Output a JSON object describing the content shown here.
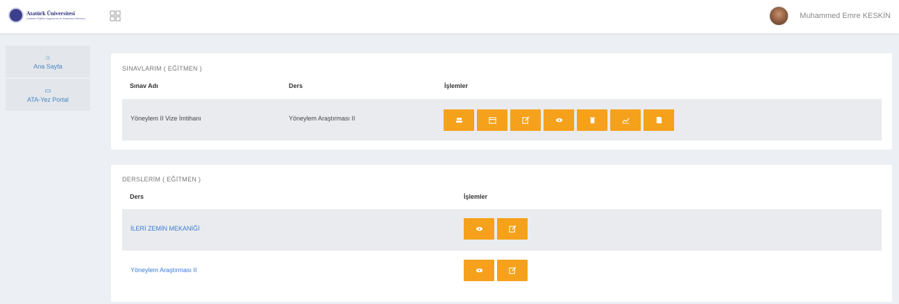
{
  "header": {
    "logo_title": "Atatürk Üniversitesi",
    "logo_sub": "Uzaktan Eğitim Uygulama ve Araştırma Merkezi",
    "user_name": "Muhammed Emre KESKİN"
  },
  "sidebar": {
    "items": [
      {
        "label": "Ana Sayfa",
        "icon": "home-icon"
      },
      {
        "label": "ATA-Yez Portal",
        "icon": "monitor-icon"
      }
    ]
  },
  "exams_panel": {
    "title": "SINAVLARIM ( EĞİTMEN )",
    "headers": [
      "Sınav Adı",
      "Ders",
      "İşlemler"
    ],
    "rows": [
      {
        "exam_name": "Yöneylem II Vize İmtihanı",
        "course": "Yöneylem Araştırması II",
        "actions": [
          "users-icon",
          "calendar-icon",
          "edit-icon",
          "eye-icon",
          "trash-icon",
          "chart-icon",
          "file-icon"
        ]
      }
    ]
  },
  "courses_panel": {
    "title": "DERSLERİM ( EĞİTMEN )",
    "headers": [
      "Ders",
      "İşlemler"
    ],
    "rows": [
      {
        "course": "İLERİ ZEMİN MEKANİĞİ",
        "actions": [
          "eye-icon",
          "edit-icon"
        ]
      },
      {
        "course": "Yöneylem Araştırması II",
        "actions": [
          "eye-icon",
          "edit-icon"
        ]
      }
    ]
  },
  "colors": {
    "accent": "#f5a11c",
    "link": "#3a7bd5",
    "background": "#eceff3"
  }
}
